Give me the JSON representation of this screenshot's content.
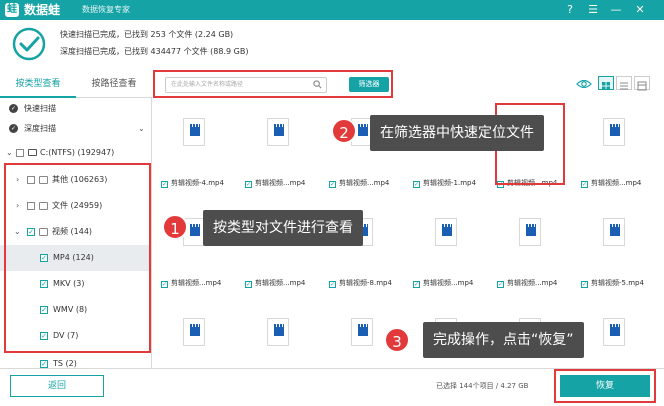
{
  "window": {
    "app_name": "数据蛙",
    "app_subtitle": "数据恢复专家",
    "controls": [
      "?",
      "☰",
      "—",
      "✕"
    ]
  },
  "status": {
    "quick_scan": "快速扫描已完成，已找到 253 个文件 (2.24 GB)",
    "deep_scan": "深度扫描已完成，已找到 434477 个文件 (88.9 GB)"
  },
  "tabs": [
    {
      "label": "按类型查看",
      "active": true
    },
    {
      "label": "按路径查看",
      "active": false
    }
  ],
  "search": {
    "placeholder": "在此处输入文件名称或路径",
    "filter_button": "筛选器"
  },
  "sidebar": {
    "quick_scan": "快速扫描",
    "deep_scan": "深度扫描",
    "drive": "C:(NTFS) (192947)",
    "groups": [
      {
        "label": "其他 (106263)",
        "expanded": false,
        "checked": false
      },
      {
        "label": "文件 (24959)",
        "expanded": false,
        "checked": false
      },
      {
        "label": "视频 (144)",
        "expanded": true,
        "checked": true
      }
    ],
    "video_types": [
      {
        "label": "MP4 (124)",
        "selected": true
      },
      {
        "label": "MKV (3)",
        "selected": false
      },
      {
        "label": "WMV (8)",
        "selected": false
      },
      {
        "label": "DV (7)",
        "selected": false
      },
      {
        "label": "TS (2)",
        "selected": false
      }
    ]
  },
  "files": [
    "剪辑视频-4.mp4",
    "剪辑视频...mp4",
    "剪辑视频...mp4",
    "剪辑视频-1.mp4",
    "剪辑视频...mp4",
    "剪辑视频...mp4",
    "剪辑视频...mp4",
    "剪辑视频...mp4",
    "剪辑视频-8.mp4",
    "剪辑视频...mp4",
    "剪辑视频...mp4",
    "剪辑视频-5.mp4",
    "",
    "",
    "",
    "",
    "",
    ""
  ],
  "callouts": [
    {
      "num": "1",
      "text": "按类型对文件进行查看"
    },
    {
      "num": "2",
      "text": "在筛选器中快速定位文件"
    },
    {
      "num": "3",
      "text": "完成操作，点击“恢复”"
    }
  ],
  "footer": {
    "back": "返回",
    "summary": "已选择 144个项目 / 4.27 GB",
    "recover": "恢复"
  },
  "colors": {
    "accent": "#16a3a6",
    "highlight": "#e23a3a",
    "callout_bg": "#4d4d4d"
  }
}
